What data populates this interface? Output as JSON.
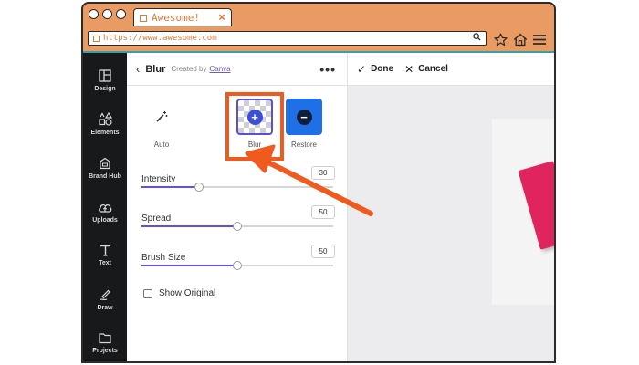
{
  "browser": {
    "tab_title": "Awesome!",
    "tab_close": "×",
    "url": "https://www.awesome.com"
  },
  "rail": {
    "items": [
      {
        "label": "Design",
        "icon": "layout-icon"
      },
      {
        "label": "Elements",
        "icon": "shapes-icon"
      },
      {
        "label": "Brand Hub",
        "icon": "brand-hub-icon"
      },
      {
        "label": "Uploads",
        "icon": "cloud-upload-icon"
      },
      {
        "label": "Text",
        "icon": "text-icon"
      },
      {
        "label": "Draw",
        "icon": "draw-icon"
      },
      {
        "label": "Projects",
        "icon": "folder-icon"
      }
    ]
  },
  "panel": {
    "back_glyph": "‹",
    "title": "Blur",
    "created_by": "Created by",
    "creator": "Canva",
    "more_glyph": "•••",
    "tools": [
      {
        "label": "Auto",
        "icon": "magic-wand-icon"
      },
      {
        "label": "Blur",
        "icon": "plus-circle-icon",
        "selected": true
      },
      {
        "label": "Restore",
        "icon": "minus-circle-icon"
      }
    ],
    "sliders": [
      {
        "label": "Intensity",
        "value": "30",
        "level": 0.3
      },
      {
        "label": "Spread",
        "value": "50",
        "level": 0.5
      },
      {
        "label": "Brush Size",
        "value": "50",
        "level": 0.5
      }
    ],
    "show_original": "Show Original",
    "show_original_checked": false
  },
  "toolbar": {
    "done_icon": "✓",
    "done_label": "Done",
    "cancel_icon": "✕",
    "cancel_label": "Cancel"
  },
  "colors": {
    "browser_frame": "#ea9a63",
    "accent": "#f05a1e",
    "slider_fill": "#6b4fd3",
    "book": "#e0245e"
  }
}
